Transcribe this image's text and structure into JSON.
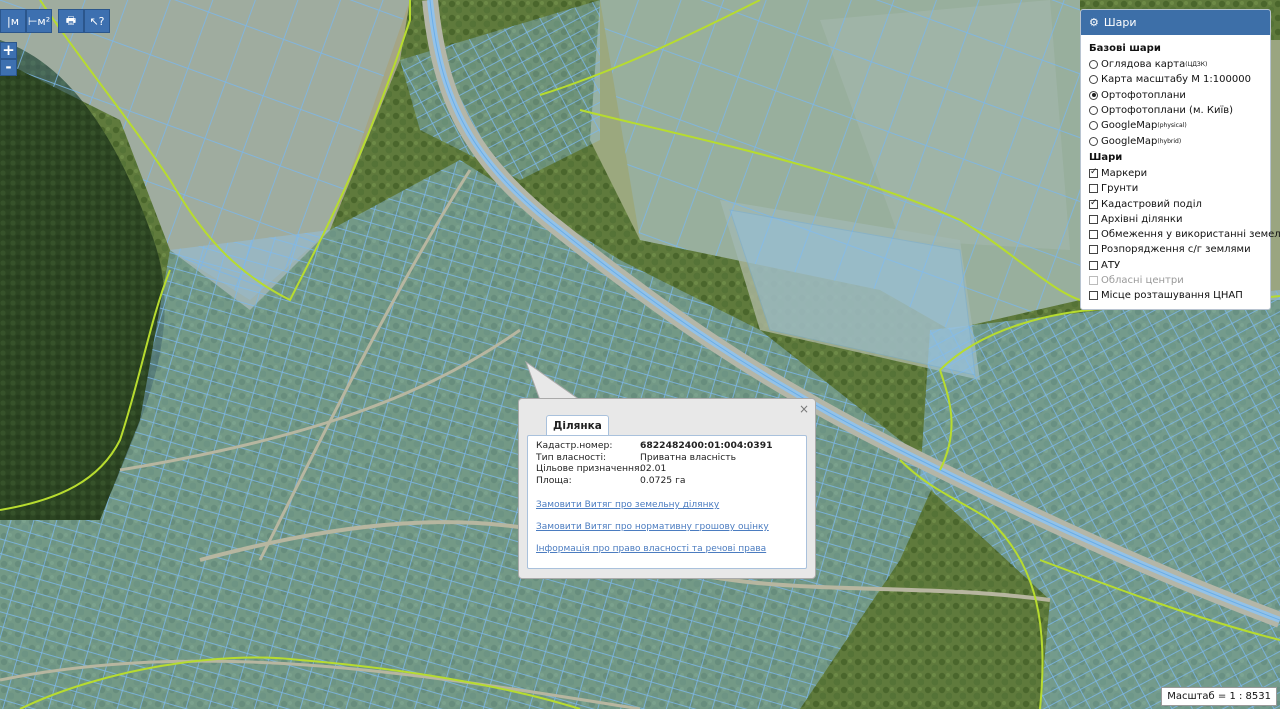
{
  "toolbar": {
    "tools": [
      {
        "name": "measure-length-button",
        "glyph": "|м"
      },
      {
        "name": "measure-area-button",
        "glyph": "⊢м²"
      },
      {
        "name": "print-button",
        "glyph": "🖶"
      },
      {
        "name": "identify-button",
        "glyph": "↖?"
      }
    ],
    "zoom_in": "+",
    "zoom_out": "-"
  },
  "layers_panel": {
    "title": "Шари",
    "base_title": "Базові шари",
    "base_layers": [
      {
        "label": "Оглядова карта",
        "sup": "(ЦДЗК)",
        "selected": false
      },
      {
        "label": "Карта масштабу М 1:100000",
        "sup": "",
        "selected": false
      },
      {
        "label": "Ортофотоплани",
        "sup": "",
        "selected": true
      },
      {
        "label": "Ортофотоплани (м. Київ)",
        "sup": "",
        "selected": false
      },
      {
        "label": "GoogleMap",
        "sup": "(physical)",
        "selected": false
      },
      {
        "label": "GoogleMap",
        "sup": "(hybrid)",
        "selected": false
      }
    ],
    "overlays_title": "Шари",
    "overlays": [
      {
        "label": "Маркери",
        "checked": true,
        "disabled": false
      },
      {
        "label": "Грунти",
        "checked": false,
        "disabled": false
      },
      {
        "label": "Кадастровий поділ",
        "checked": true,
        "disabled": false
      },
      {
        "label": "Архівні ділянки",
        "checked": false,
        "disabled": false
      },
      {
        "label": "Обмеження у використанні земель",
        "checked": false,
        "disabled": false
      },
      {
        "label": "Розпорядження с/г землями",
        "checked": false,
        "disabled": false
      },
      {
        "label": "АТУ",
        "checked": false,
        "disabled": false
      },
      {
        "label": "Обласні центри",
        "checked": false,
        "disabled": true
      },
      {
        "label": "Місце розташування ЦНАП",
        "checked": false,
        "disabled": false
      }
    ]
  },
  "popup": {
    "tab": "Ділянка",
    "close": "×",
    "fields": [
      {
        "key": "Кадастр.номер:",
        "value": "6822482400:01:004:0391",
        "bold": true
      },
      {
        "key": "Тип власності:",
        "value": "Приватна власність",
        "bold": false
      },
      {
        "key": "Цільове призначення:",
        "value": "02.01",
        "bold": false
      },
      {
        "key": "Площа:",
        "value": "0.0725 га",
        "bold": false
      }
    ],
    "links": [
      "Замовити Витяг про земельну ділянку",
      "Замовити Витяг про нормативну грошову оцінку",
      "Інформація про право власності та речові права"
    ]
  },
  "scale": "Масштаб = 1 : 8531",
  "colors": {
    "parcel_fill": "#8fc3ee",
    "parcel_stroke": "#6aaee8",
    "boundary": "#b7dc2f",
    "forest": "#2f4a24",
    "field": "#9aa07e",
    "road": "#b9b9a8"
  }
}
